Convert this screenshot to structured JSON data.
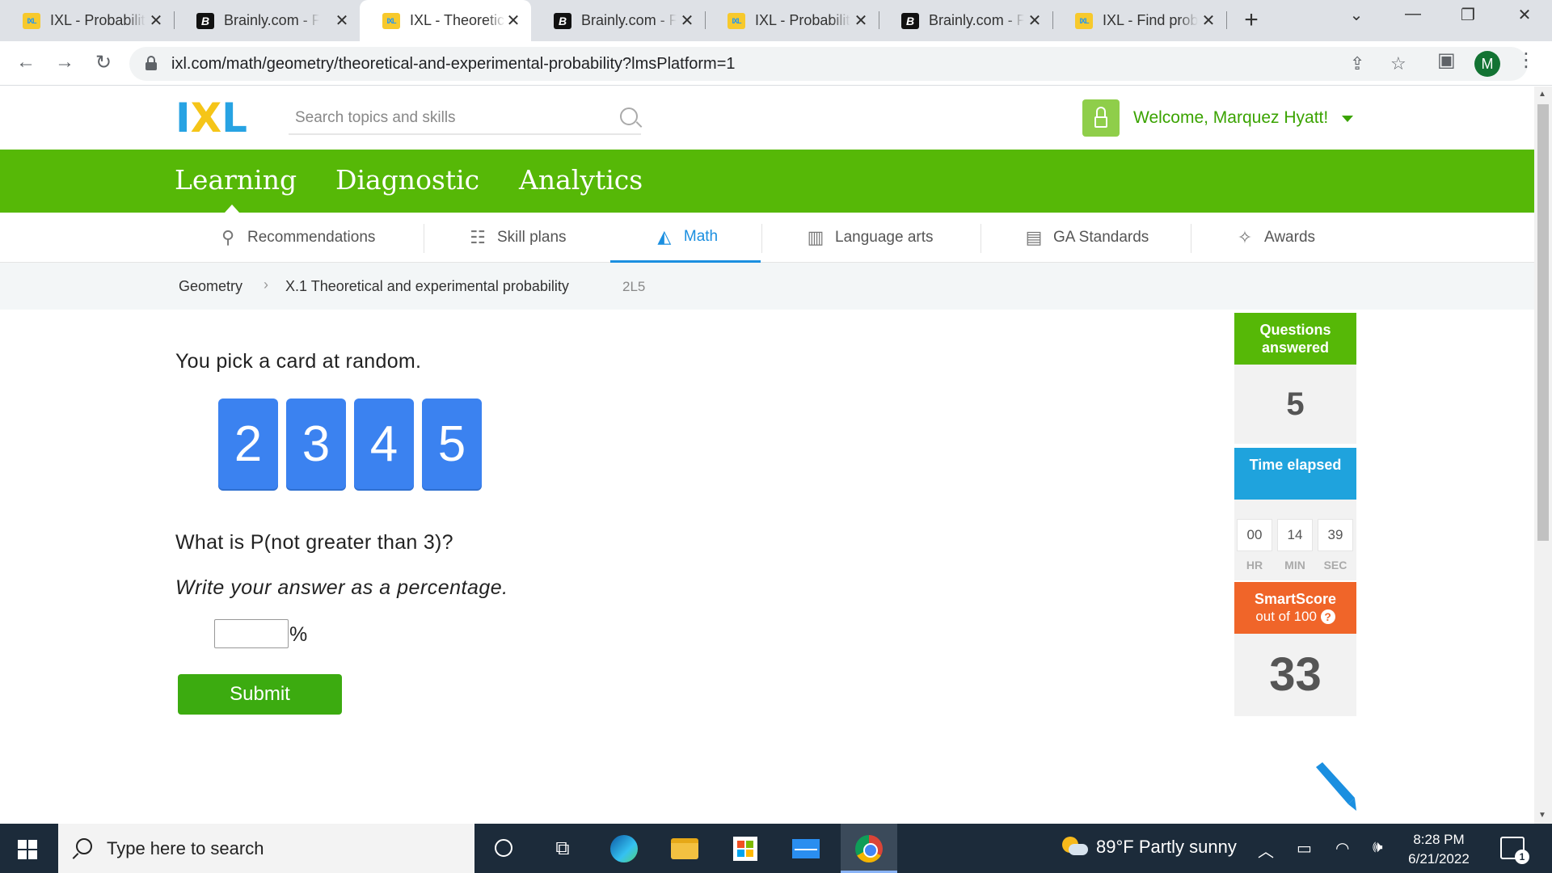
{
  "browser": {
    "tabs": [
      {
        "title": "IXL - Probability",
        "favicon": "ixl-favicon"
      },
      {
        "title": "Brainly.com - For",
        "favicon": "brainly-favicon"
      },
      {
        "title": "IXL - Theoretical",
        "favicon": "ixl-favicon",
        "active": true
      },
      {
        "title": "Brainly.com - For",
        "favicon": "brainly-favicon"
      },
      {
        "title": "IXL - Probability",
        "favicon": "ixl-favicon"
      },
      {
        "title": "Brainly.com - For",
        "favicon": "brainly-favicon"
      },
      {
        "title": "IXL - Find probab",
        "favicon": "ixl-favicon"
      }
    ],
    "url": "ixl.com/math/geometry/theoretical-and-experimental-probability?lmsPlatform=1",
    "profile_initial": "M"
  },
  "header": {
    "logo": {
      "l1": "I",
      "l2": "X",
      "l3": "L"
    },
    "search_placeholder": "Search topics and skills",
    "welcome": "Welcome, Marquez Hyatt!"
  },
  "main_nav": [
    "Learning",
    "Diagnostic",
    "Analytics"
  ],
  "sub_nav": [
    {
      "label": "Recommendations",
      "icon": "recommendations-icon"
    },
    {
      "label": "Skill plans",
      "icon": "skill-plans-icon"
    },
    {
      "label": "Math",
      "icon": "math-pyramid-icon",
      "active": true
    },
    {
      "label": "Language arts",
      "icon": "book-icon"
    },
    {
      "label": "GA Standards",
      "icon": "clipboard-icon"
    },
    {
      "label": "Awards",
      "icon": "awards-icon"
    }
  ],
  "breadcrumb": {
    "subject": "Geometry",
    "skill": "X.1 Theoretical and experimental probability",
    "code": "2L5"
  },
  "problem": {
    "prompt": "You pick a card at random.",
    "cards": [
      "2",
      "3",
      "4",
      "5"
    ],
    "question": "What is P(not greater than 3)?",
    "instruction": "Write your answer as a percentage.",
    "answer_value": "",
    "unit": "%",
    "submit_label": "Submit"
  },
  "stats": {
    "questions_answered_label": "Questions answered",
    "questions_answered": "5",
    "time_label": "Time elapsed",
    "time": {
      "hr": "00",
      "min": "14",
      "sec": "39"
    },
    "time_units": {
      "hr": "HR",
      "min": "MIN",
      "sec": "SEC"
    },
    "smartscore_label": "SmartScore",
    "smartscore_sub": "out of 100",
    "smartscore": "33",
    "colors": {
      "questions": "#56b807",
      "time": "#1fa3dd",
      "smartscore": "#f06529"
    }
  },
  "taskbar": {
    "search_placeholder": "Type here to search",
    "weather": "89°F  Partly sunny",
    "time": "8:28 PM",
    "date": "6/21/2022",
    "notifications": "1"
  }
}
